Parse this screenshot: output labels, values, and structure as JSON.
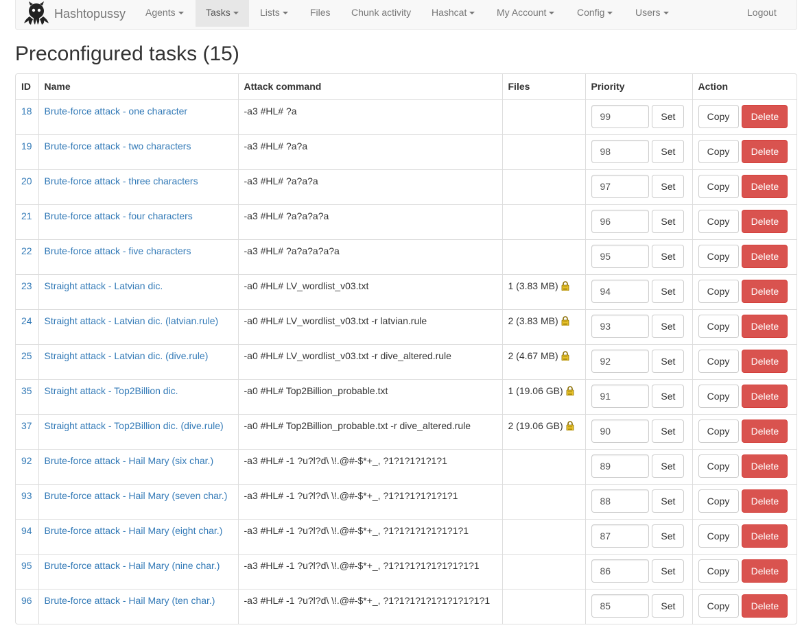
{
  "brand": {
    "name": "Hashtopussy",
    "logo_icon": "octopus-logo-icon"
  },
  "nav": {
    "agents": "Agents",
    "tasks": "Tasks",
    "lists": "Lists",
    "files": "Files",
    "chunk_activity": "Chunk activity",
    "hashcat": "Hashcat",
    "my_account": "My Account",
    "config": "Config",
    "users": "Users",
    "logout": "Logout"
  },
  "page_title": "Preconfigured tasks (15)",
  "table": {
    "headers": {
      "id": "ID",
      "name": "Name",
      "attack": "Attack command",
      "files": "Files",
      "priority": "Priority",
      "action": "Action"
    },
    "set_label": "Set",
    "copy_label": "Copy",
    "delete_label": "Delete",
    "rows": [
      {
        "id": "18",
        "name": "Brute-force attack - one character",
        "attack": "-a3 #HL# ?a",
        "files": "",
        "locked": false,
        "priority": "99"
      },
      {
        "id": "19",
        "name": "Brute-force attack - two characters",
        "attack": "-a3 #HL# ?a?a",
        "files": "",
        "locked": false,
        "priority": "98"
      },
      {
        "id": "20",
        "name": "Brute-force attack - three characters",
        "attack": "-a3 #HL# ?a?a?a",
        "files": "",
        "locked": false,
        "priority": "97"
      },
      {
        "id": "21",
        "name": "Brute-force attack - four characters",
        "attack": "-a3 #HL# ?a?a?a?a",
        "files": "",
        "locked": false,
        "priority": "96"
      },
      {
        "id": "22",
        "name": "Brute-force attack - five characters",
        "attack": "-a3 #HL# ?a?a?a?a?a",
        "files": "",
        "locked": false,
        "priority": "95"
      },
      {
        "id": "23",
        "name": "Straight attack - Latvian dic.",
        "attack": "-a0 #HL# LV_wordlist_v03.txt",
        "files": "1 (3.83 MB)",
        "locked": true,
        "priority": "94"
      },
      {
        "id": "24",
        "name": "Straight attack - Latvian dic. (latvian.rule)",
        "attack": "-a0 #HL# LV_wordlist_v03.txt -r latvian.rule",
        "files": "2 (3.83 MB)",
        "locked": true,
        "priority": "93"
      },
      {
        "id": "25",
        "name": "Straight attack - Latvian dic. (dive.rule)",
        "attack": "-a0 #HL# LV_wordlist_v03.txt -r dive_altered.rule",
        "files": "2 (4.67 MB)",
        "locked": true,
        "priority": "92"
      },
      {
        "id": "35",
        "name": "Straight attack - Top2Billion dic.",
        "attack": "-a0 #HL# Top2Billion_probable.txt",
        "files": "1 (19.06 GB)",
        "locked": true,
        "priority": "91"
      },
      {
        "id": "37",
        "name": "Straight attack - Top2Billion dic. (dive.rule)",
        "attack": "-a0 #HL# Top2Billion_probable.txt -r dive_altered.rule",
        "files": "2 (19.06 GB)",
        "locked": true,
        "priority": "90"
      },
      {
        "id": "92",
        "name": "Brute-force attack - Hail Mary (six char.)",
        "attack": "-a3 #HL# -1 ?u?l?d\\ \\!.@#-$*+_, ?1?1?1?1?1?1",
        "files": "",
        "locked": false,
        "priority": "89"
      },
      {
        "id": "93",
        "name": "Brute-force attack - Hail Mary (seven char.)",
        "attack": "-a3 #HL# -1 ?u?l?d\\ \\!.@#-$*+_, ?1?1?1?1?1?1?1",
        "files": "",
        "locked": false,
        "priority": "88"
      },
      {
        "id": "94",
        "name": "Brute-force attack - Hail Mary (eight char.)",
        "attack": "-a3 #HL# -1 ?u?l?d\\ \\!.@#-$*+_, ?1?1?1?1?1?1?1?1",
        "files": "",
        "locked": false,
        "priority": "87"
      },
      {
        "id": "95",
        "name": "Brute-force attack - Hail Mary (nine char.)",
        "attack": "-a3 #HL# -1 ?u?l?d\\ \\!.@#-$*+_, ?1?1?1?1?1?1?1?1?1",
        "files": "",
        "locked": false,
        "priority": "86"
      },
      {
        "id": "96",
        "name": "Brute-force attack - Hail Mary (ten char.)",
        "attack": "-a3 #HL# -1 ?u?l?d\\ \\!.@#-$*+_, ?1?1?1?1?1?1?1?1?1?1",
        "files": "",
        "locked": false,
        "priority": "85"
      }
    ]
  },
  "colors": {
    "link": "#337ab7",
    "danger": "#d9534f",
    "navbar_bg": "#f8f8f8",
    "active_nav_bg": "#e7e7e7"
  }
}
